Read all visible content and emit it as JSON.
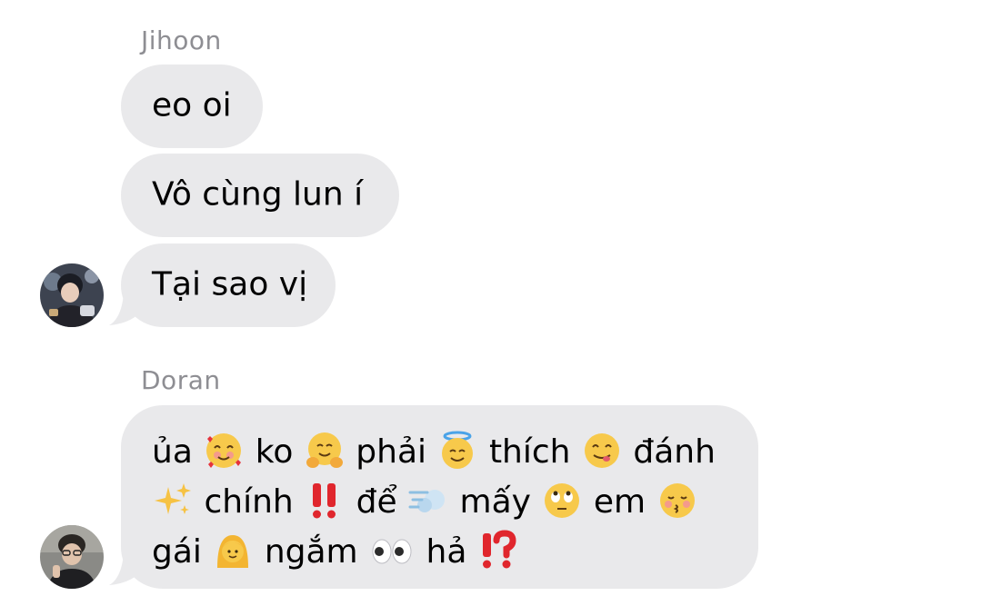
{
  "thread": {
    "group1": {
      "sender": "Jihoon",
      "messages": [
        "eo oi",
        "Vô cùng lun í",
        "Tại sao vị"
      ]
    },
    "group2": {
      "sender": "Doran",
      "line1": {
        "w1": "ủa",
        "w2": "ko",
        "w3": "phải",
        "w4": "thích",
        "w5": "đánh"
      },
      "line2": {
        "w1": "chính",
        "w2": "để",
        "w3": "mấy",
        "w4": "em"
      },
      "line3": {
        "w1": "gái",
        "w2": "ngắm",
        "w3": "hả"
      },
      "emoji_names": [
        "smiling-face-with-hearts",
        "hugging-face",
        "smiling-face-with-halo",
        "face-savoring-food",
        "sparkles",
        "double-exclamation",
        "dashing-away",
        "face-with-rolling-eyes",
        "kissing-face-with-closed-eyes",
        "person-blond-hair",
        "eyes",
        "exclamation-question-mark"
      ]
    }
  },
  "colors": {
    "bubble_incoming": "#e9e9eb",
    "sender_name": "#8e8e93",
    "background": "#ffffff"
  }
}
